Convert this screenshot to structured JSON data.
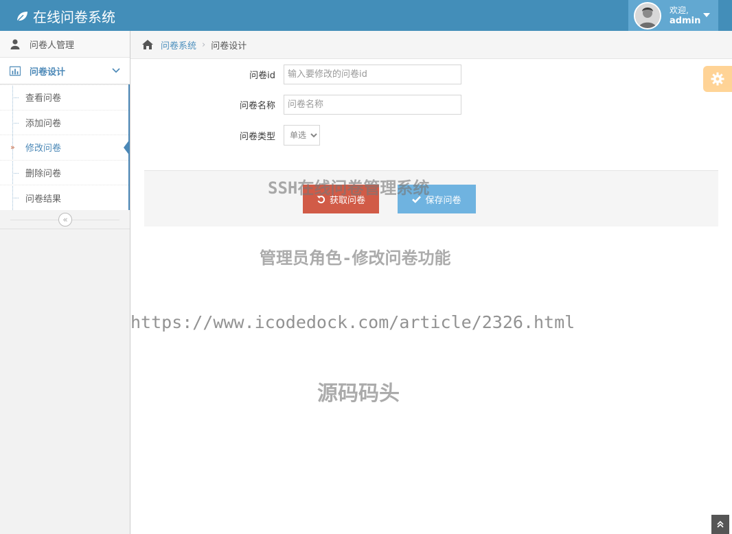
{
  "app": {
    "title": "在线问卷系统"
  },
  "user": {
    "welcome": "欢迎,",
    "name": "admin"
  },
  "sidebar": {
    "items": [
      {
        "label": "问卷人管理",
        "icon": "user-icon"
      },
      {
        "label": "问卷设计",
        "icon": "bar-chart-icon",
        "open": true
      }
    ],
    "submenu": [
      {
        "label": "查看问卷"
      },
      {
        "label": "添加问卷"
      },
      {
        "label": "修改问卷",
        "active": true
      },
      {
        "label": "删除问卷"
      },
      {
        "label": "问卷结果"
      }
    ]
  },
  "breadcrumb": {
    "root": "问卷系统",
    "current": "问卷设计"
  },
  "form": {
    "id_label": "问卷id",
    "id_placeholder": "输入要修改的问卷id",
    "name_label": "问卷名称",
    "name_placeholder": "问卷名称",
    "type_label": "问卷类型",
    "type_value": "单选"
  },
  "actions": {
    "fetch_label": "获取问卷",
    "save_label": "保存问卷"
  },
  "watermark": {
    "line1": "SSH在线问卷管理系统",
    "line2": "管理员角色-修改问卷功能",
    "line3": "https://www.icodedock.com/article/2326.html",
    "line4": "源码码头"
  },
  "colors": {
    "navbar": "#438eb9",
    "user_box": "#62a8d1",
    "danger": "#d15b47",
    "info": "#6fb3e0",
    "settings": "#ffb752"
  }
}
